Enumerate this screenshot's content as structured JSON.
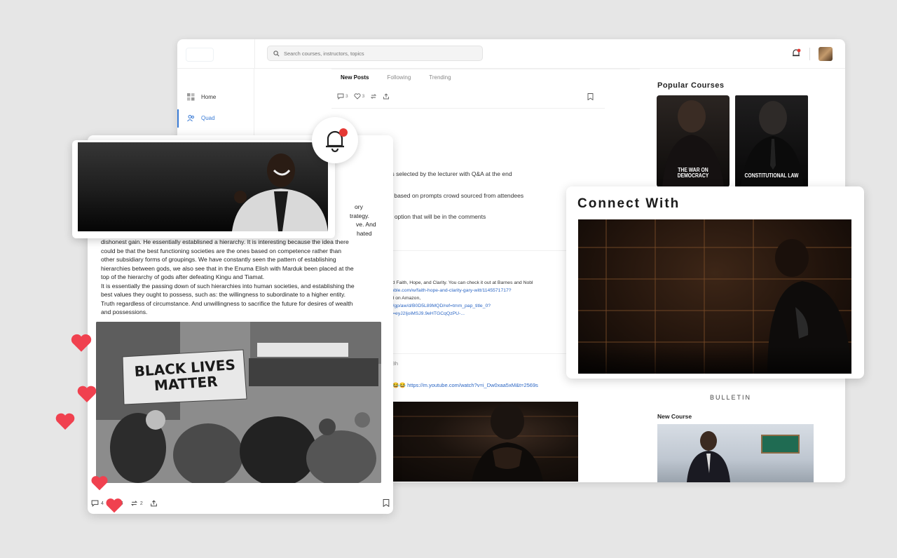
{
  "header": {
    "search_placeholder": "Search courses, instructors, topics"
  },
  "sidebar": {
    "items": [
      {
        "label": "Home",
        "icon": "grid-icon"
      },
      {
        "label": "Quad",
        "icon": "users-icon",
        "active": true
      }
    ]
  },
  "feed": {
    "tabs": [
      {
        "label": "New Posts",
        "active": true
      },
      {
        "label": "Following"
      },
      {
        "label": "Trending"
      }
    ],
    "post1_actions": {
      "comments": "3",
      "likes": "3"
    },
    "poll_options": [
      "res selected by the lecturer with Q&A at the end",
      "ns based on prompts crowd sourced from attendees",
      "ne option that will be in the comments"
    ],
    "post2_meta": "h",
    "post2_links": [
      "itled Faith, Hope, and Clarity. You can check it out at Barnes and Nobl",
      "dnoble.com/w/faith-hope-and-clarity-gary-witt/1145571717?",
      "and on Amazon,",
      "om/gp/aw/d/B0D5L89MQD/ref=tmm_pap_title_0?",
      "dlb=eyJ2IjoiMSJ9.9eHTGCqQzPU-..."
    ],
    "post3_meta": "r 23h",
    "post3_link": "https://m.youtube.com/watch?v=i_Dw0xaa5xM&t=2569s",
    "post3_emoji": "🙏🏾😂😂"
  },
  "right": {
    "popular_title": "Popular Courses",
    "courses": [
      {
        "caption": "THE WAR ON DEMOCRACY"
      },
      {
        "caption": "CONSTITUTIONAL LAW"
      }
    ],
    "bulletin": "BULLETIN",
    "new_course_title": "New Course"
  },
  "post_card": {
    "paragraph_lines": [
      "ory",
      "trategy.",
      "ve. And",
      "hated",
      "dishonest gain. He essentially establisned a hierarchy. It is interesting because the idea there",
      "could be that the best functioning societies are the ones based on competence rather than",
      "other subsidiary forms of groupings. We have constantly seen the pattern of establishing",
      "hierarchies between gods, we also see that in the Enuma Elish with Marduk been placed at the",
      "top of the hierarchy of gods after defeating Kingu and Tiamat.",
      "It is essentially the passing down of such hierarchies into human societies, and establishing the",
      "best values they ought to possess, such as: the willingness to subordinate to a higher entity.",
      "Truth regardless of circumstance. And unwillingness to sacrifice the future for desires of wealth",
      "and possessions."
    ],
    "image_text": {
      "sign": "BLACK LIVES MATTER"
    },
    "actions": {
      "comments": "4",
      "likes": "4",
      "reposts": "2"
    }
  },
  "connect": {
    "title": "Connect With"
  },
  "colors": {
    "accent": "#3a7bd5",
    "heart": "#f0414f",
    "notif_dot": "#e53935"
  }
}
